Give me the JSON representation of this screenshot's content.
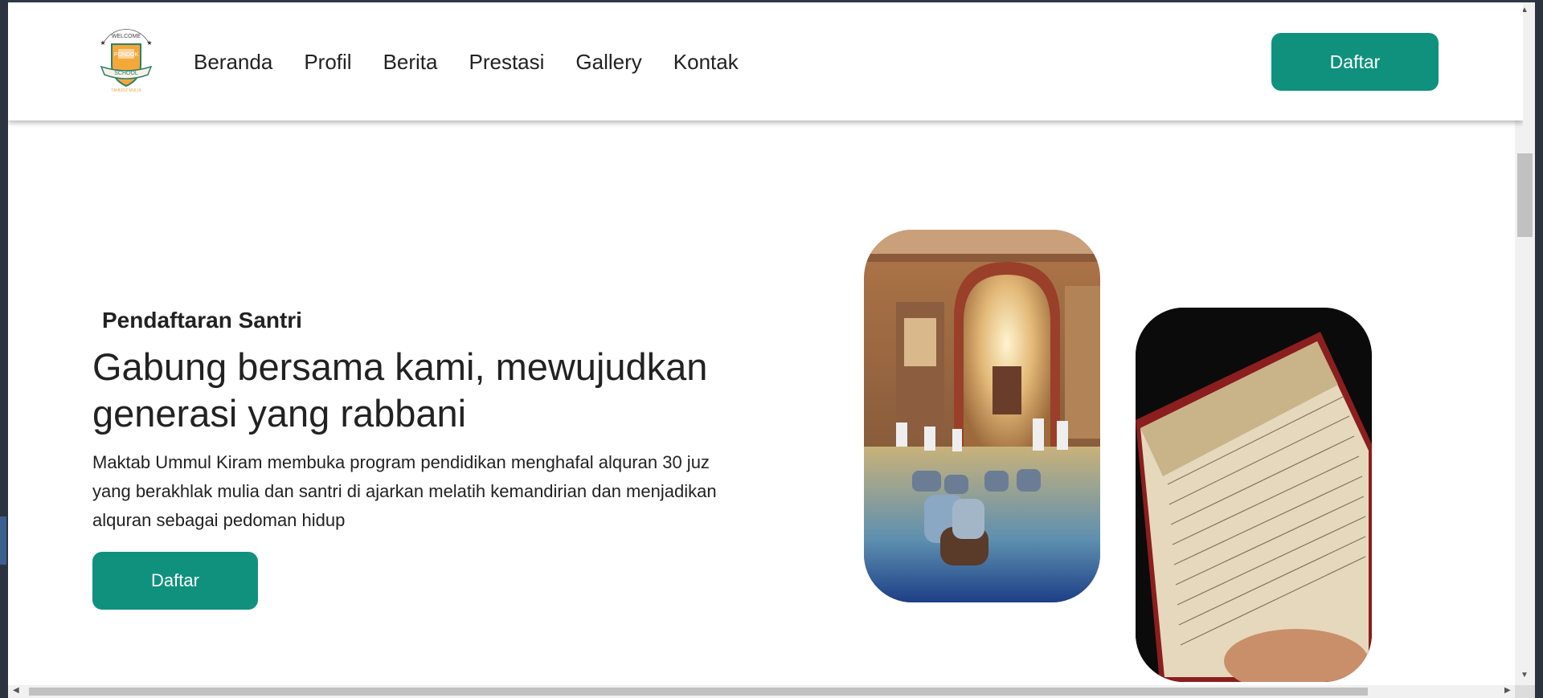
{
  "header": {
    "logo_text": [
      "WELCOME",
      "PONDOK",
      "SCHOOL",
      "TAHFIDZ MULIA"
    ],
    "nav": [
      {
        "label": "Beranda"
      },
      {
        "label": "Profil"
      },
      {
        "label": "Berita"
      },
      {
        "label": "Prestasi"
      },
      {
        "label": "Gallery"
      },
      {
        "label": "Kontak"
      }
    ],
    "cta_label": "Daftar"
  },
  "hero": {
    "subtitle": "Pendaftaran Santri",
    "headline": "Gabung bersama kami, mewujudkan generasi yang rabbani",
    "description": "Maktab Ummul Kiram membuka program pendidikan menghafal alquran 30 juz yang berakhlak mulia dan santri di ajarkan melatih kemandirian dan menjadikan alquran sebagai pedoman hidup",
    "cta_label": "Daftar"
  },
  "colors": {
    "accent": "#0f917e",
    "text": "#222222"
  },
  "icons": [
    "school-logo-icon",
    "scroll-up-arrow-icon",
    "scroll-down-arrow-icon",
    "scroll-left-arrow-icon",
    "scroll-right-arrow-icon"
  ]
}
